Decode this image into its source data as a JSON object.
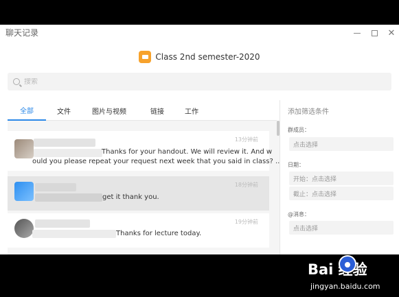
{
  "window": {
    "title": "聊天记录"
  },
  "chat": {
    "name": "Class 2nd semester-2020",
    "icon": "group-chat-icon",
    "icon_color": "#f7a22c"
  },
  "search": {
    "placeholder": "搜索"
  },
  "tabs": [
    {
      "label": "全部",
      "active": true
    },
    {
      "label": "文件",
      "active": false
    },
    {
      "label": "图片与视频",
      "active": false
    },
    {
      "label": "链接",
      "active": false
    },
    {
      "label": "工作",
      "active": false
    }
  ],
  "messages": [
    {
      "text_line1": "Thanks for your handout. We will review it. And w",
      "text_line2": "ould you please repeat your request next week that you said in class? ...",
      "time": "13分钟前",
      "selected": false
    },
    {
      "text_line1": "get it thank you.",
      "time": "18分钟前",
      "selected": true
    },
    {
      "text_line1": "Thanks for lecture today.",
      "time": "19分钟前",
      "selected": false
    }
  ],
  "filter": {
    "title": "添加筛选条件",
    "member_label": "群成员：",
    "member_placeholder": "点击选择",
    "date_label": "日期：",
    "start_placeholder": "开始：点击选择",
    "end_placeholder": "截止：点击选择",
    "mention_label": "@消息：",
    "mention_placeholder": "点击选择"
  },
  "colors": {
    "accent": "#2b88e8",
    "selected_row": "#e5e5e5"
  },
  "watermark": {
    "logo": "Bai   经验",
    "url": "jingyan.baidu.com"
  }
}
